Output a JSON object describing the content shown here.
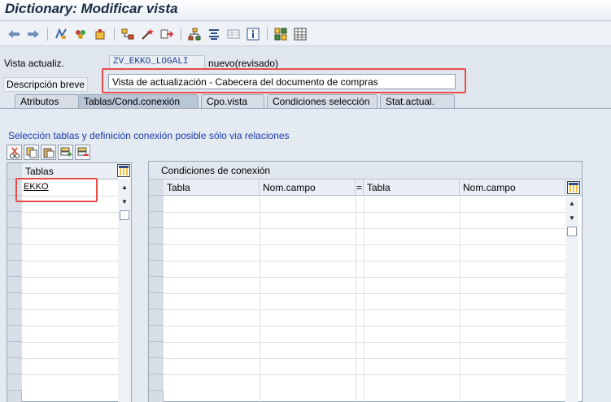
{
  "window": {
    "title": "Dictionary: Modificar vista"
  },
  "toolbar": {
    "icons": [
      "back-arrow-icon",
      "forward-arrow-icon",
      "display-change-icon",
      "other-object-icon",
      "activate-icon",
      "hierarchy-icon",
      "magic-wand-icon",
      "transport-icon",
      "tree-icon",
      "align-icon",
      "table-icon",
      "info-icon",
      "grid-config-icon",
      "list-icon"
    ]
  },
  "header": {
    "vista_label": "Vista actualiz.",
    "vista_value": "ZV_EKKO_LOGALI",
    "vista_status": "nuevo(revisado)",
    "descripcion_label": "Descripción breve",
    "descripcion_value": "Vista de actualización - Cabecera del documento de compras"
  },
  "tabs": [
    {
      "label": "Atributos",
      "active": false
    },
    {
      "label": "Tablas/Cond.conexión",
      "active": true
    },
    {
      "label": "Cpo.vista",
      "active": false
    },
    {
      "label": "Condiciones selección",
      "active": false
    },
    {
      "label": "Stat.actual.",
      "active": false
    }
  ],
  "panel": {
    "hint": "Selección tablas y definición conexión posible sólo via relaciones",
    "small_tools": [
      "cut-icon",
      "copy-icon",
      "paste-icon",
      "insert-row-icon",
      "delete-row-icon"
    ]
  },
  "tables_grid": {
    "header": "Tablas",
    "rows": [
      "EKKO"
    ]
  },
  "conditions_grid": {
    "title": "Condiciones de conexión",
    "columns": [
      "Tabla",
      "Nom.campo",
      "=",
      "Tabla",
      "Nom.campo"
    ]
  },
  "colors": {
    "accent_blue": "#1a3bb0",
    "highlight_red": "#e84a4a",
    "background": "#dfe6ee"
  }
}
